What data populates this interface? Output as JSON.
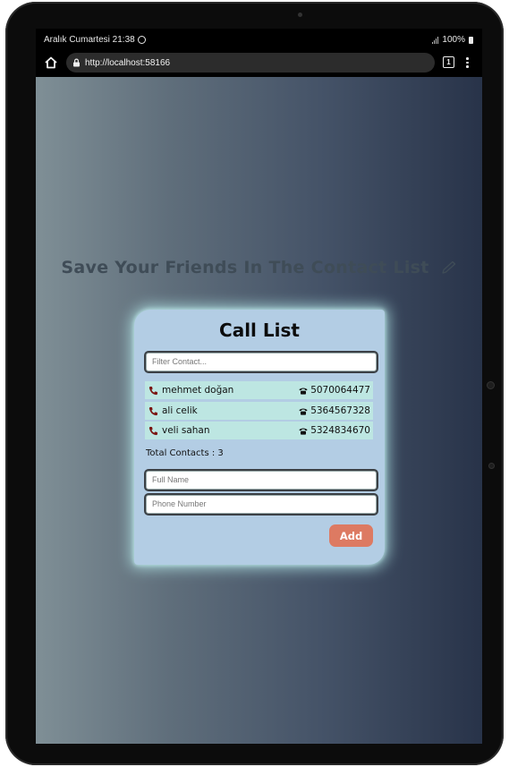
{
  "status_bar": {
    "datetime": "Aralık Cumartesi 21:38",
    "battery": "100%"
  },
  "browser": {
    "url": "http://localhost:58166",
    "tab_count": "1"
  },
  "page": {
    "headline": "Save Your Friends In The Contact List",
    "card_title": "Call List",
    "filter_placeholder": "Filter Contact...",
    "contacts": [
      {
        "name": "mehmet doğan",
        "phone": "5070064477"
      },
      {
        "name": "ali celik",
        "phone": "5364567328"
      },
      {
        "name": "veli sahan",
        "phone": "5324834670"
      }
    ],
    "total_label": "Total Contacts : 3",
    "fullname_placeholder": "Full Name",
    "phone_placeholder": "Phone Number",
    "add_label": "Add"
  },
  "colors": {
    "card_bg": "#b3cde4",
    "row_bg": "#bde6e2",
    "add_button": "#dd7a62",
    "glow": "#b9f0f0"
  },
  "icons": [
    "home-icon",
    "lock-icon",
    "kebab-menu-icon",
    "pencil-icon",
    "phone-icon",
    "telephone-icon"
  ]
}
